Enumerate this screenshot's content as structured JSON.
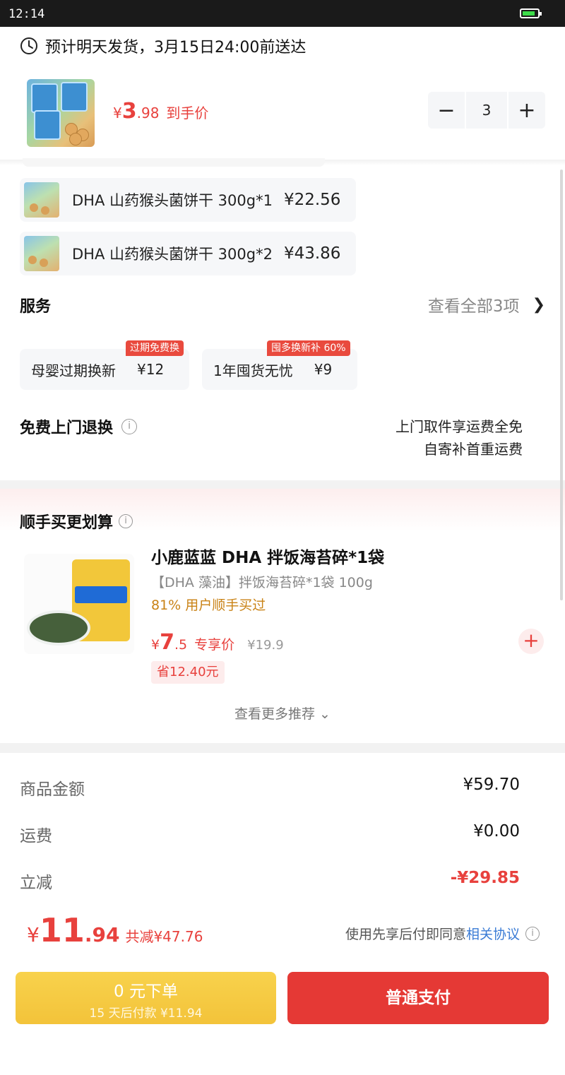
{
  "status_bar": {
    "time": "12:14",
    "battery_level": 0.85
  },
  "delivery": {
    "text": "预计明天发货，3月15日24:00前送达"
  },
  "product": {
    "price_symbol": "¥",
    "price_int": "3",
    "price_dec": ".98",
    "price_tag": "到手价",
    "quantity": "3",
    "minus_label": "−",
    "plus_label": "+"
  },
  "bundles": [
    {
      "name": "DHA 山药猴头菌饼干 300g*1",
      "price": "¥22.56"
    },
    {
      "name": "DHA 山药猴头菌饼干 300g*2",
      "price": "¥43.86"
    }
  ],
  "services": {
    "title": "服务",
    "view_all": "查看全部3项",
    "items": [
      {
        "name": "母婴过期换新",
        "price": "¥12",
        "badge": "过期免费换"
      },
      {
        "name": "1年囤货无忧",
        "price": "¥9",
        "badge": "囤多换新补 60%"
      }
    ]
  },
  "free_return": {
    "title": "免费上门退换",
    "note_line1": "上门取件享运费全免",
    "note_line2": "自寄补首重运费"
  },
  "addon": {
    "section_title": "顺手买更划算",
    "name": "小鹿蓝蓝 DHA 拌饭海苔碎*1袋",
    "spec": "【DHA 藻油】拌饭海苔碎*1袋 100g",
    "buy_rate": "81% 用户顺手买过",
    "price_symbol": "¥",
    "price_int": "7",
    "price_dec": ".5",
    "price_tag": "专享价",
    "original_price": "¥19.9",
    "save_text": "省12.40元",
    "more": "查看更多推荐 ⌄"
  },
  "summary": {
    "rows": [
      {
        "label": "商品金额",
        "value": "¥59.70"
      },
      {
        "label": "运费",
        "value": "¥0.00"
      },
      {
        "label": "立减",
        "value": "-¥29.85"
      }
    ]
  },
  "total": {
    "symbol": "¥",
    "int": "11",
    "dec": ".94",
    "saved": "共减¥47.76",
    "agree_text": "使用先享后付即同意",
    "agree_link": "相关协议"
  },
  "actions": {
    "bnpl_main": "0 元下单",
    "bnpl_sub": "15 天后付款 ¥11.94",
    "pay": "普通支付"
  },
  "colors": {
    "accent_red": "#e8413d",
    "bnpl_yellow": "#f5c842",
    "pay_red": "#e53935"
  }
}
